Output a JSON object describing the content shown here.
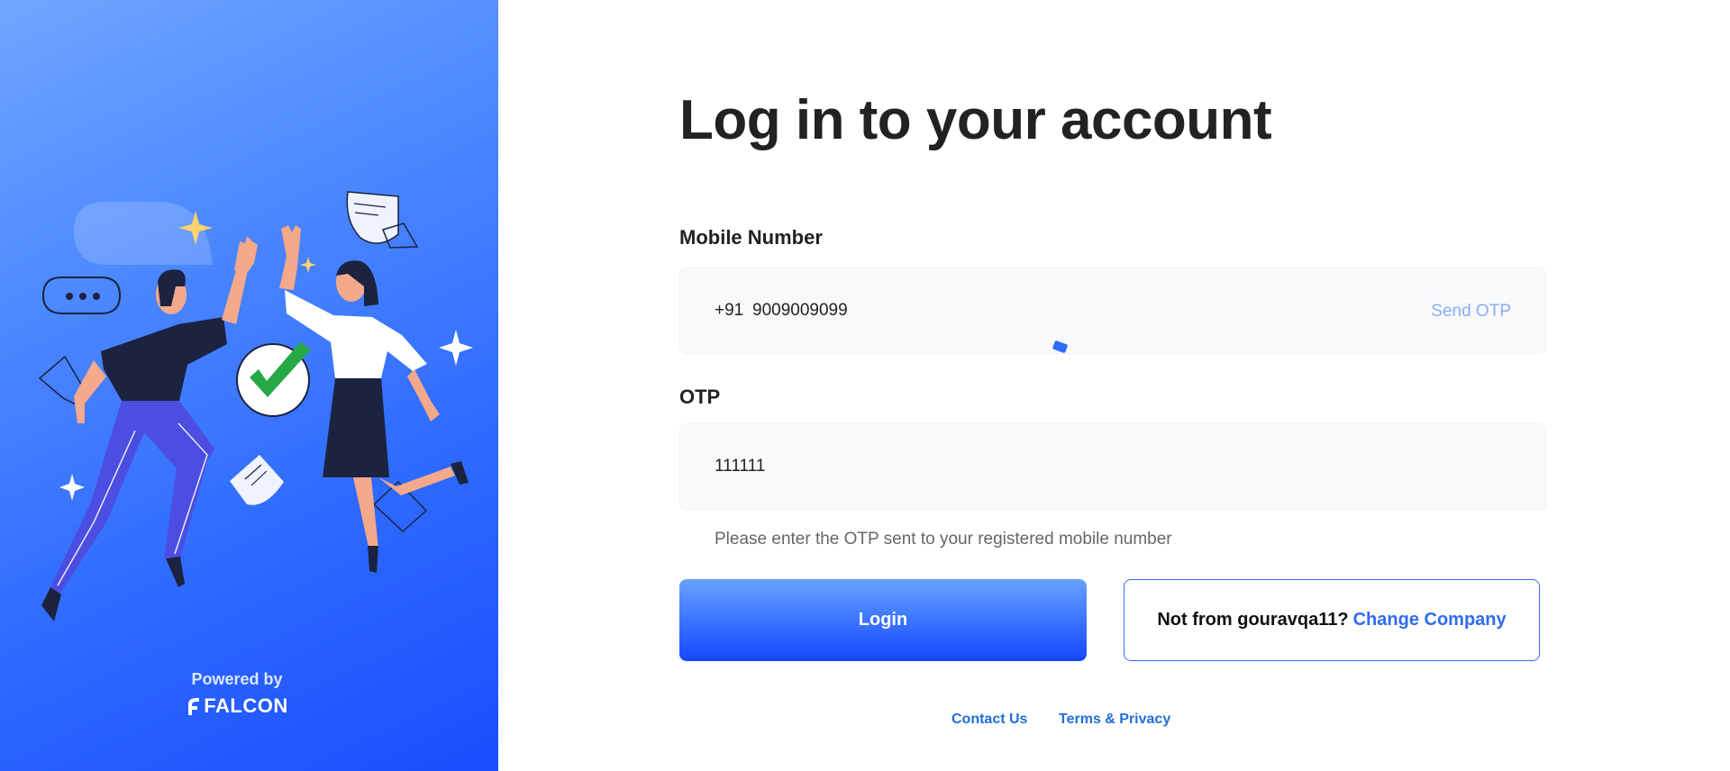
{
  "sidebar": {
    "powered_label": "Powered by",
    "brand_name": "FALCON",
    "gradient_colors": [
      "#6fa6ff",
      "#2f6bff",
      "#1a4dff"
    ]
  },
  "login": {
    "title": "Log in to your account",
    "mobile_label": "Mobile Number",
    "country_code": "+91",
    "mobile_value": "9009009099",
    "send_otp_label": "Send OTP",
    "otp_label": "OTP",
    "otp_value": "111111",
    "helper_text": "Please enter the OTP sent to your registered mobile number",
    "login_button": "Login",
    "not_from_text": "Not from gouravqa11?",
    "change_company_label": "Change Company"
  },
  "footer": {
    "contact": "Contact Us",
    "terms": "Terms & Privacy"
  },
  "colors": {
    "accent": "#2f6bff",
    "link": "#1f6fd6",
    "send_otp": "#88aef5"
  }
}
